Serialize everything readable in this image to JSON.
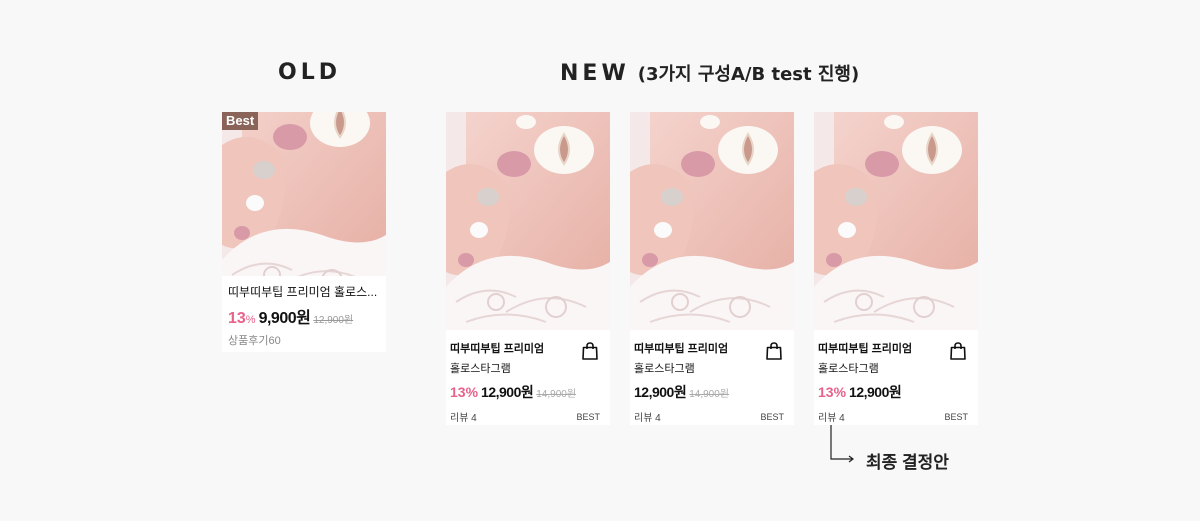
{
  "old": {
    "title": "OLD",
    "badge": "Best",
    "name": "띠부띠부팁 프리미엄 홀로스...",
    "discount": "13",
    "discount_unit": "%",
    "price": "9,900원",
    "original_price": "12,900원",
    "review": "상품후기60"
  },
  "new": {
    "title": "NEW",
    "subtitle": "(3가지 구성A/B test 진행)",
    "cards": [
      {
        "name_line1": "띠부띠부팁 프리미엄",
        "name_line2": "홀로스타그램",
        "discount": "13%",
        "price": "12,900원",
        "original_price": "14,900원",
        "review": "리뷰 4",
        "badge": "BEST"
      },
      {
        "name_line1": "띠부띠부팁 프리미엄",
        "name_line2": "홀로스타그램",
        "discount": "",
        "price": "12,900원",
        "original_price": "14,900원",
        "review": "리뷰 4",
        "badge": "BEST"
      },
      {
        "name_line1": "띠부띠부팁 프리미엄",
        "name_line2": "홀로스타그램",
        "discount": "13%",
        "price": "12,900원",
        "original_price": "",
        "review": "리뷰 4",
        "badge": "BEST"
      }
    ]
  },
  "final_label": "최종 결정안",
  "icons": {
    "bag": "shopping-bag-icon",
    "arrow": "corner-arrow-icon"
  },
  "colors": {
    "discount": "#e8628a",
    "badge_bg": "#8a6458",
    "background": "#f8f8f8"
  }
}
